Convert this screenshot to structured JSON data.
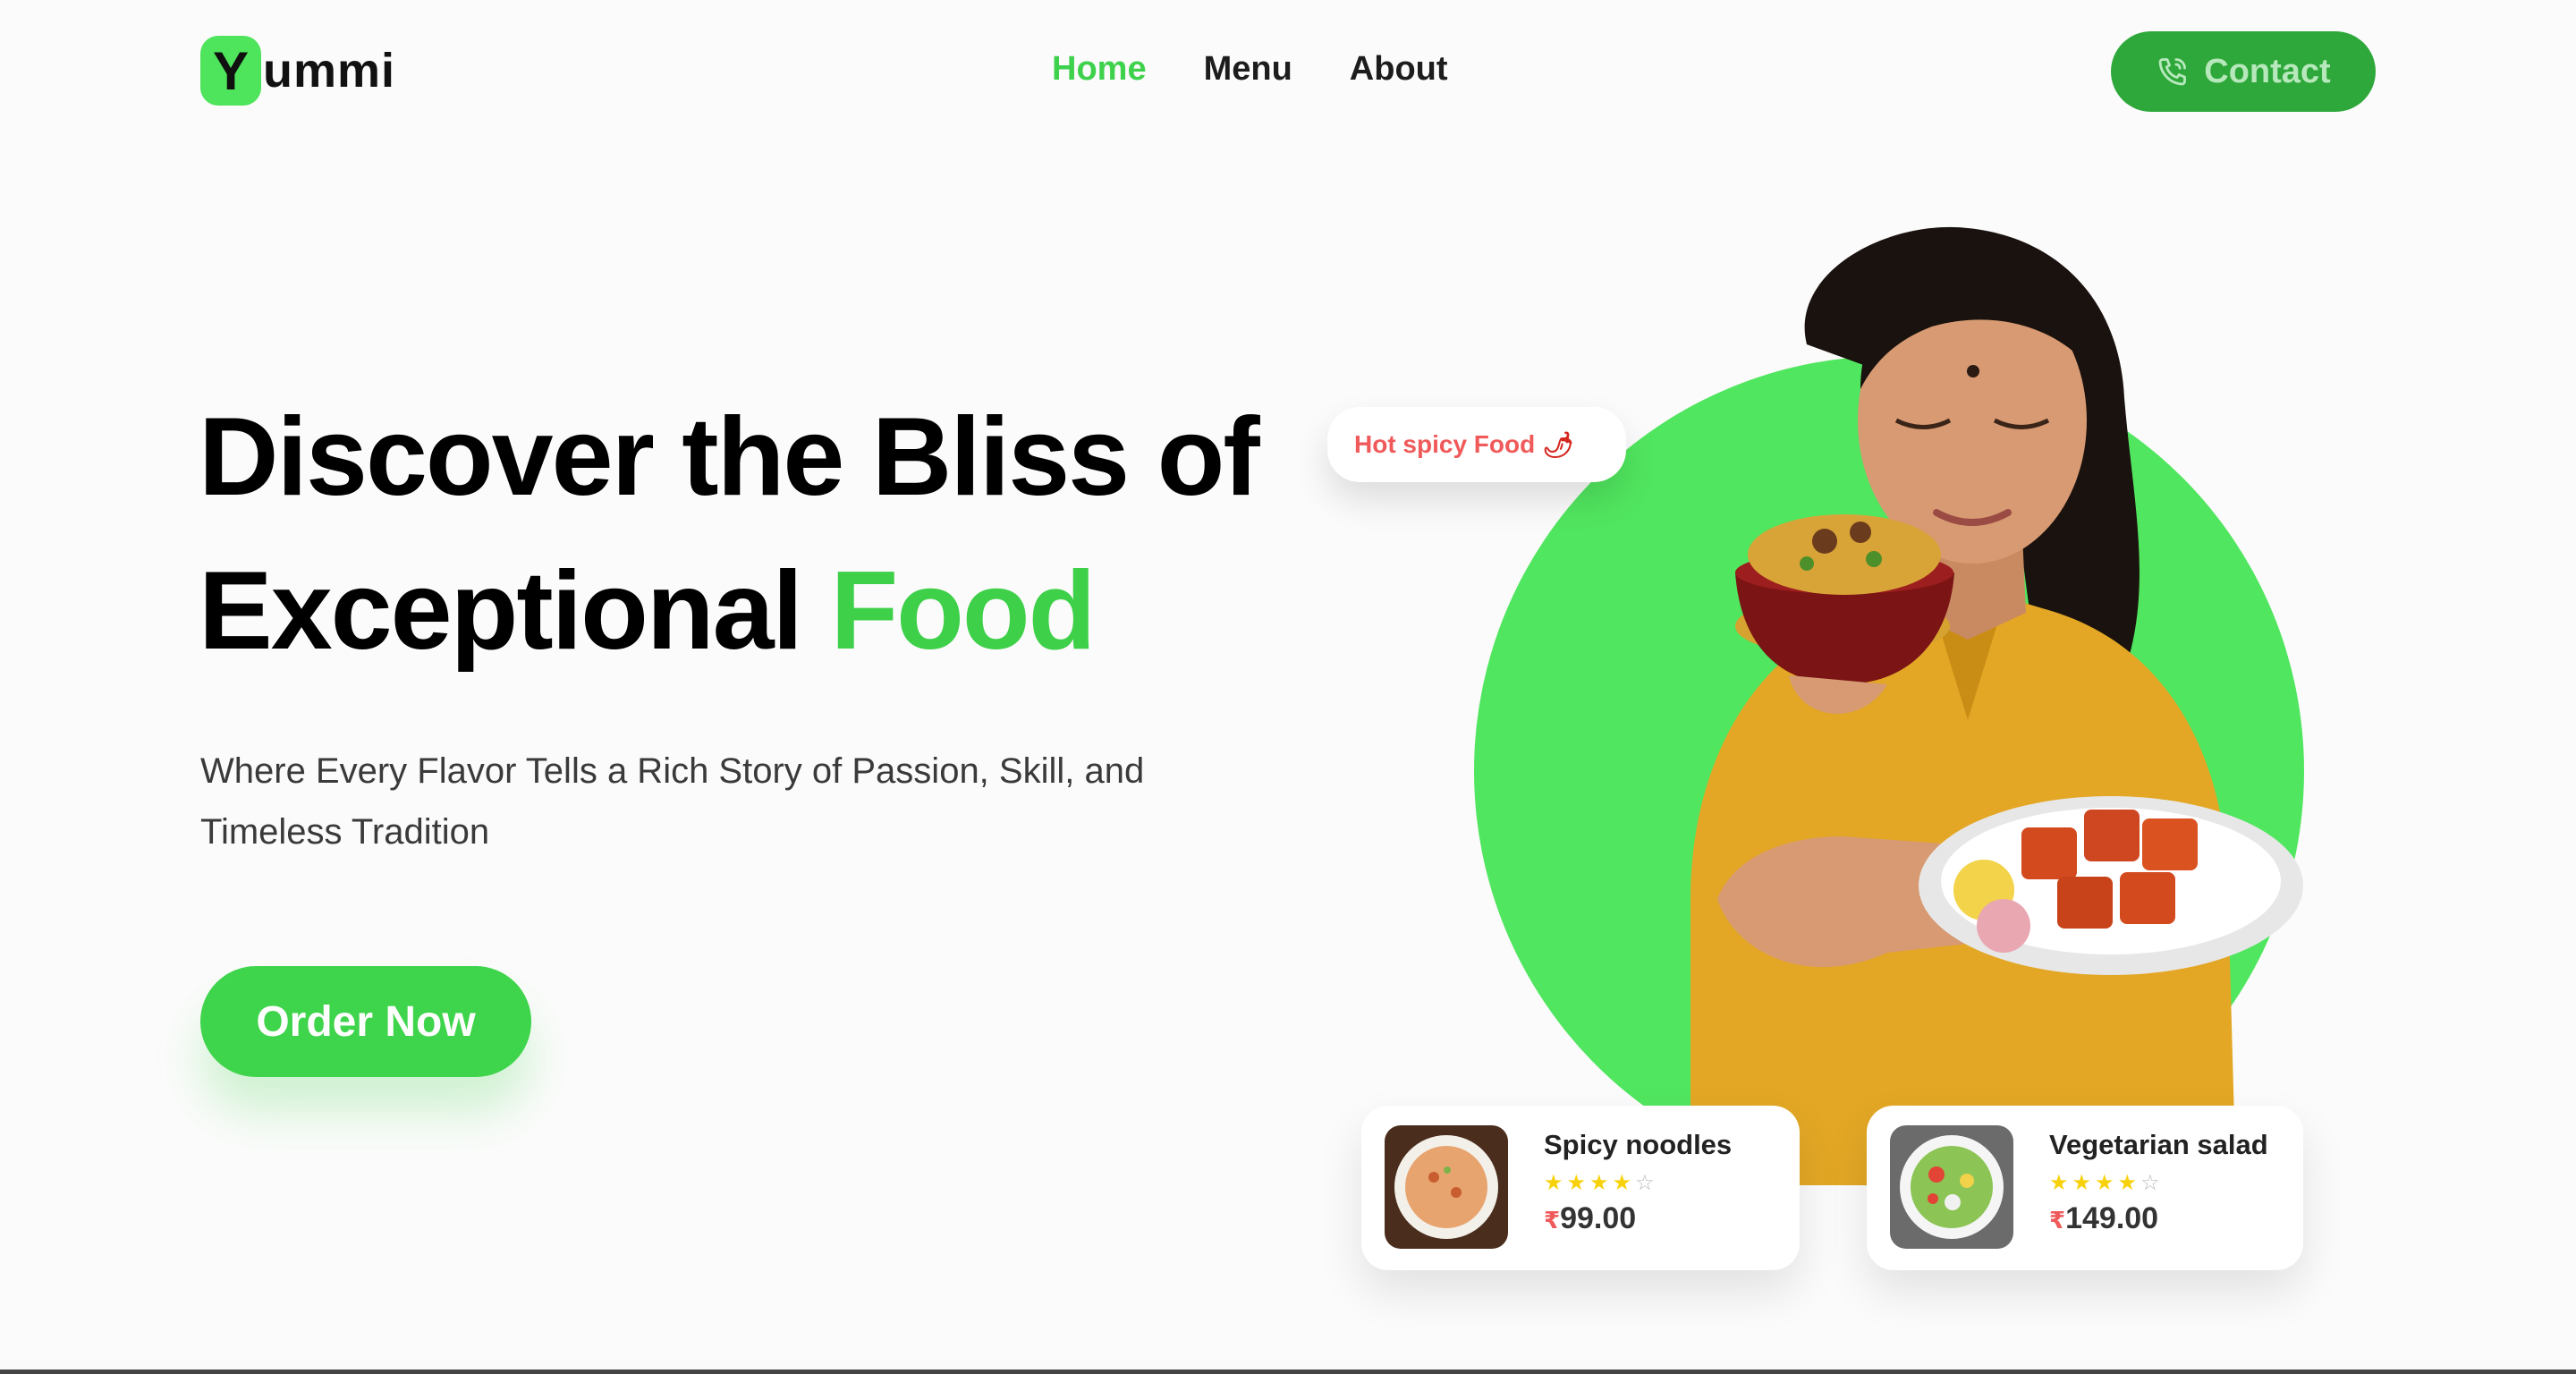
{
  "brand": {
    "logo_letter": "Y",
    "logo_text": "ummi"
  },
  "nav": {
    "items": [
      {
        "label": "Home"
      },
      {
        "label": "Menu"
      },
      {
        "label": "About"
      }
    ]
  },
  "contact": {
    "label": "Contact",
    "icon": "phone-icon"
  },
  "hero": {
    "title_line1": "Discover the Bliss of",
    "title_line2_main": "Exceptional ",
    "title_line2_accent": "Food",
    "subtitle": "Where Every Flavor Tells a Rich Story of Passion, Skill, and Timeless Tradition",
    "cta": "Order Now"
  },
  "bubble": {
    "text": "Hot spicy Food",
    "icon": "chili-icon"
  },
  "cards": [
    {
      "name": "Spicy noodles",
      "rating": 4,
      "max_rating": 5,
      "currency": "₹",
      "price": "99.00",
      "stars_on": "★★★★",
      "stars_off": "☆"
    },
    {
      "name": "Vegetarian salad",
      "rating": 4,
      "max_rating": 5,
      "currency": "₹",
      "price": "149.00",
      "stars_on": "★★★★",
      "stars_off": "☆"
    }
  ],
  "colors": {
    "accent": "#3ed14c",
    "circle": "#51e65f",
    "contact_bg": "#2ea83a",
    "price_currency": "#f05a5a"
  }
}
